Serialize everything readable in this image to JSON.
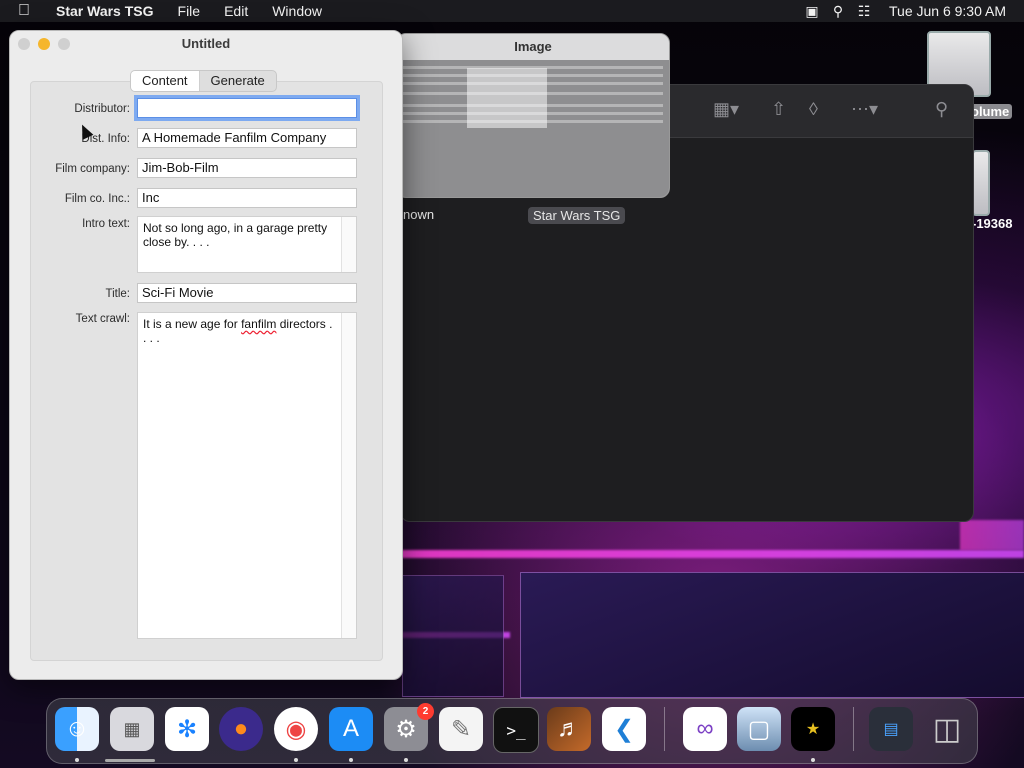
{
  "menubar": {
    "apple_icon": "apple-icon",
    "app_name": "Star Wars TSG",
    "menus": [
      "File",
      "Edit",
      "Window"
    ],
    "datetime": "Tue Jun 6  9:30 AM"
  },
  "desktop": {
    "volume_label": "olume",
    "disk2_label": "-19368"
  },
  "finder": {
    "item_unknown": "nown",
    "item_selected": "Star Wars TSG"
  },
  "image_window": {
    "title": "Image"
  },
  "main_window": {
    "title": "Untitled",
    "tabs": [
      "Content",
      "Generate"
    ],
    "active_tab": "Content",
    "fields": {
      "distributor": {
        "label": "Distributor:",
        "value": ""
      },
      "dist_info": {
        "label": "Dist. Info:",
        "value": "A Homemade Fanfilm Company"
      },
      "film_company": {
        "label": "Film company:",
        "value": "Jim-Bob-Film"
      },
      "film_co_inc": {
        "label": "Film co. Inc.:",
        "value": "Inc"
      },
      "intro_text": {
        "label": "Intro text:",
        "value": "Not so long ago, in a garage pretty close by. . . ."
      },
      "title": {
        "label": "Title:",
        "value": "Sci-Fi Movie"
      },
      "text_crawl": {
        "label": "Text crawl:",
        "value_pre": "It is a new age for ",
        "value_misspelled": "fanfilm",
        "value_post": " directors . . . ."
      }
    }
  },
  "dock": {
    "apps": [
      "finder-icon",
      "launchpad-icon",
      "safari-icon",
      "firefox-icon",
      "chrome-icon",
      "app-store-icon",
      "system-preferences-icon",
      "textedit-icon",
      "terminal-icon",
      "garageband-icon",
      "vscode-icon",
      "visual-studio-icon",
      "preview-icon",
      "star-wars-tsg-icon",
      "downloads-icon",
      "trash-icon"
    ],
    "system_prefs_badge": "2"
  }
}
